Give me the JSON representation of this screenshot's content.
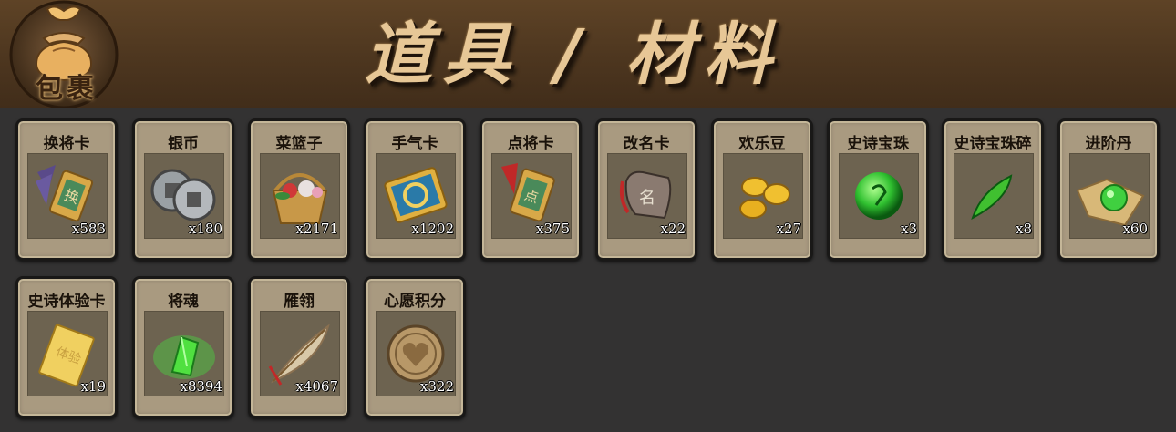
{
  "header": {
    "bag_label": "包裹",
    "title": "道具 / 材料"
  },
  "items": [
    {
      "name": "换将卡",
      "count": "x583",
      "icon": "swap-general-card-icon"
    },
    {
      "name": "银币",
      "count": "x180",
      "icon": "silver-coin-icon"
    },
    {
      "name": "菜篮子",
      "count": "x2171",
      "icon": "vegetable-basket-icon"
    },
    {
      "name": "手气卡",
      "count": "x1202",
      "icon": "luck-card-icon"
    },
    {
      "name": "点将卡",
      "count": "x375",
      "icon": "select-general-card-icon"
    },
    {
      "name": "改名卡",
      "count": "x22",
      "icon": "rename-card-icon"
    },
    {
      "name": "欢乐豆",
      "count": "x27",
      "icon": "happy-bean-icon"
    },
    {
      "name": "史诗宝珠",
      "count": "x3",
      "icon": "epic-orb-icon"
    },
    {
      "name": "史诗宝珠碎",
      "count": "x8",
      "icon": "epic-orb-shard-icon"
    },
    {
      "name": "进阶丹",
      "count": "x60",
      "icon": "advance-pill-icon"
    },
    {
      "name": "史诗体验卡",
      "count": "x19",
      "icon": "epic-trial-card-icon"
    },
    {
      "name": "将魂",
      "count": "x8394",
      "icon": "general-soul-crystal-icon"
    },
    {
      "name": "雁翎",
      "count": "x4067",
      "icon": "goose-feather-icon"
    },
    {
      "name": "心愿积分",
      "count": "x322",
      "icon": "wish-points-coin-icon"
    }
  ]
}
